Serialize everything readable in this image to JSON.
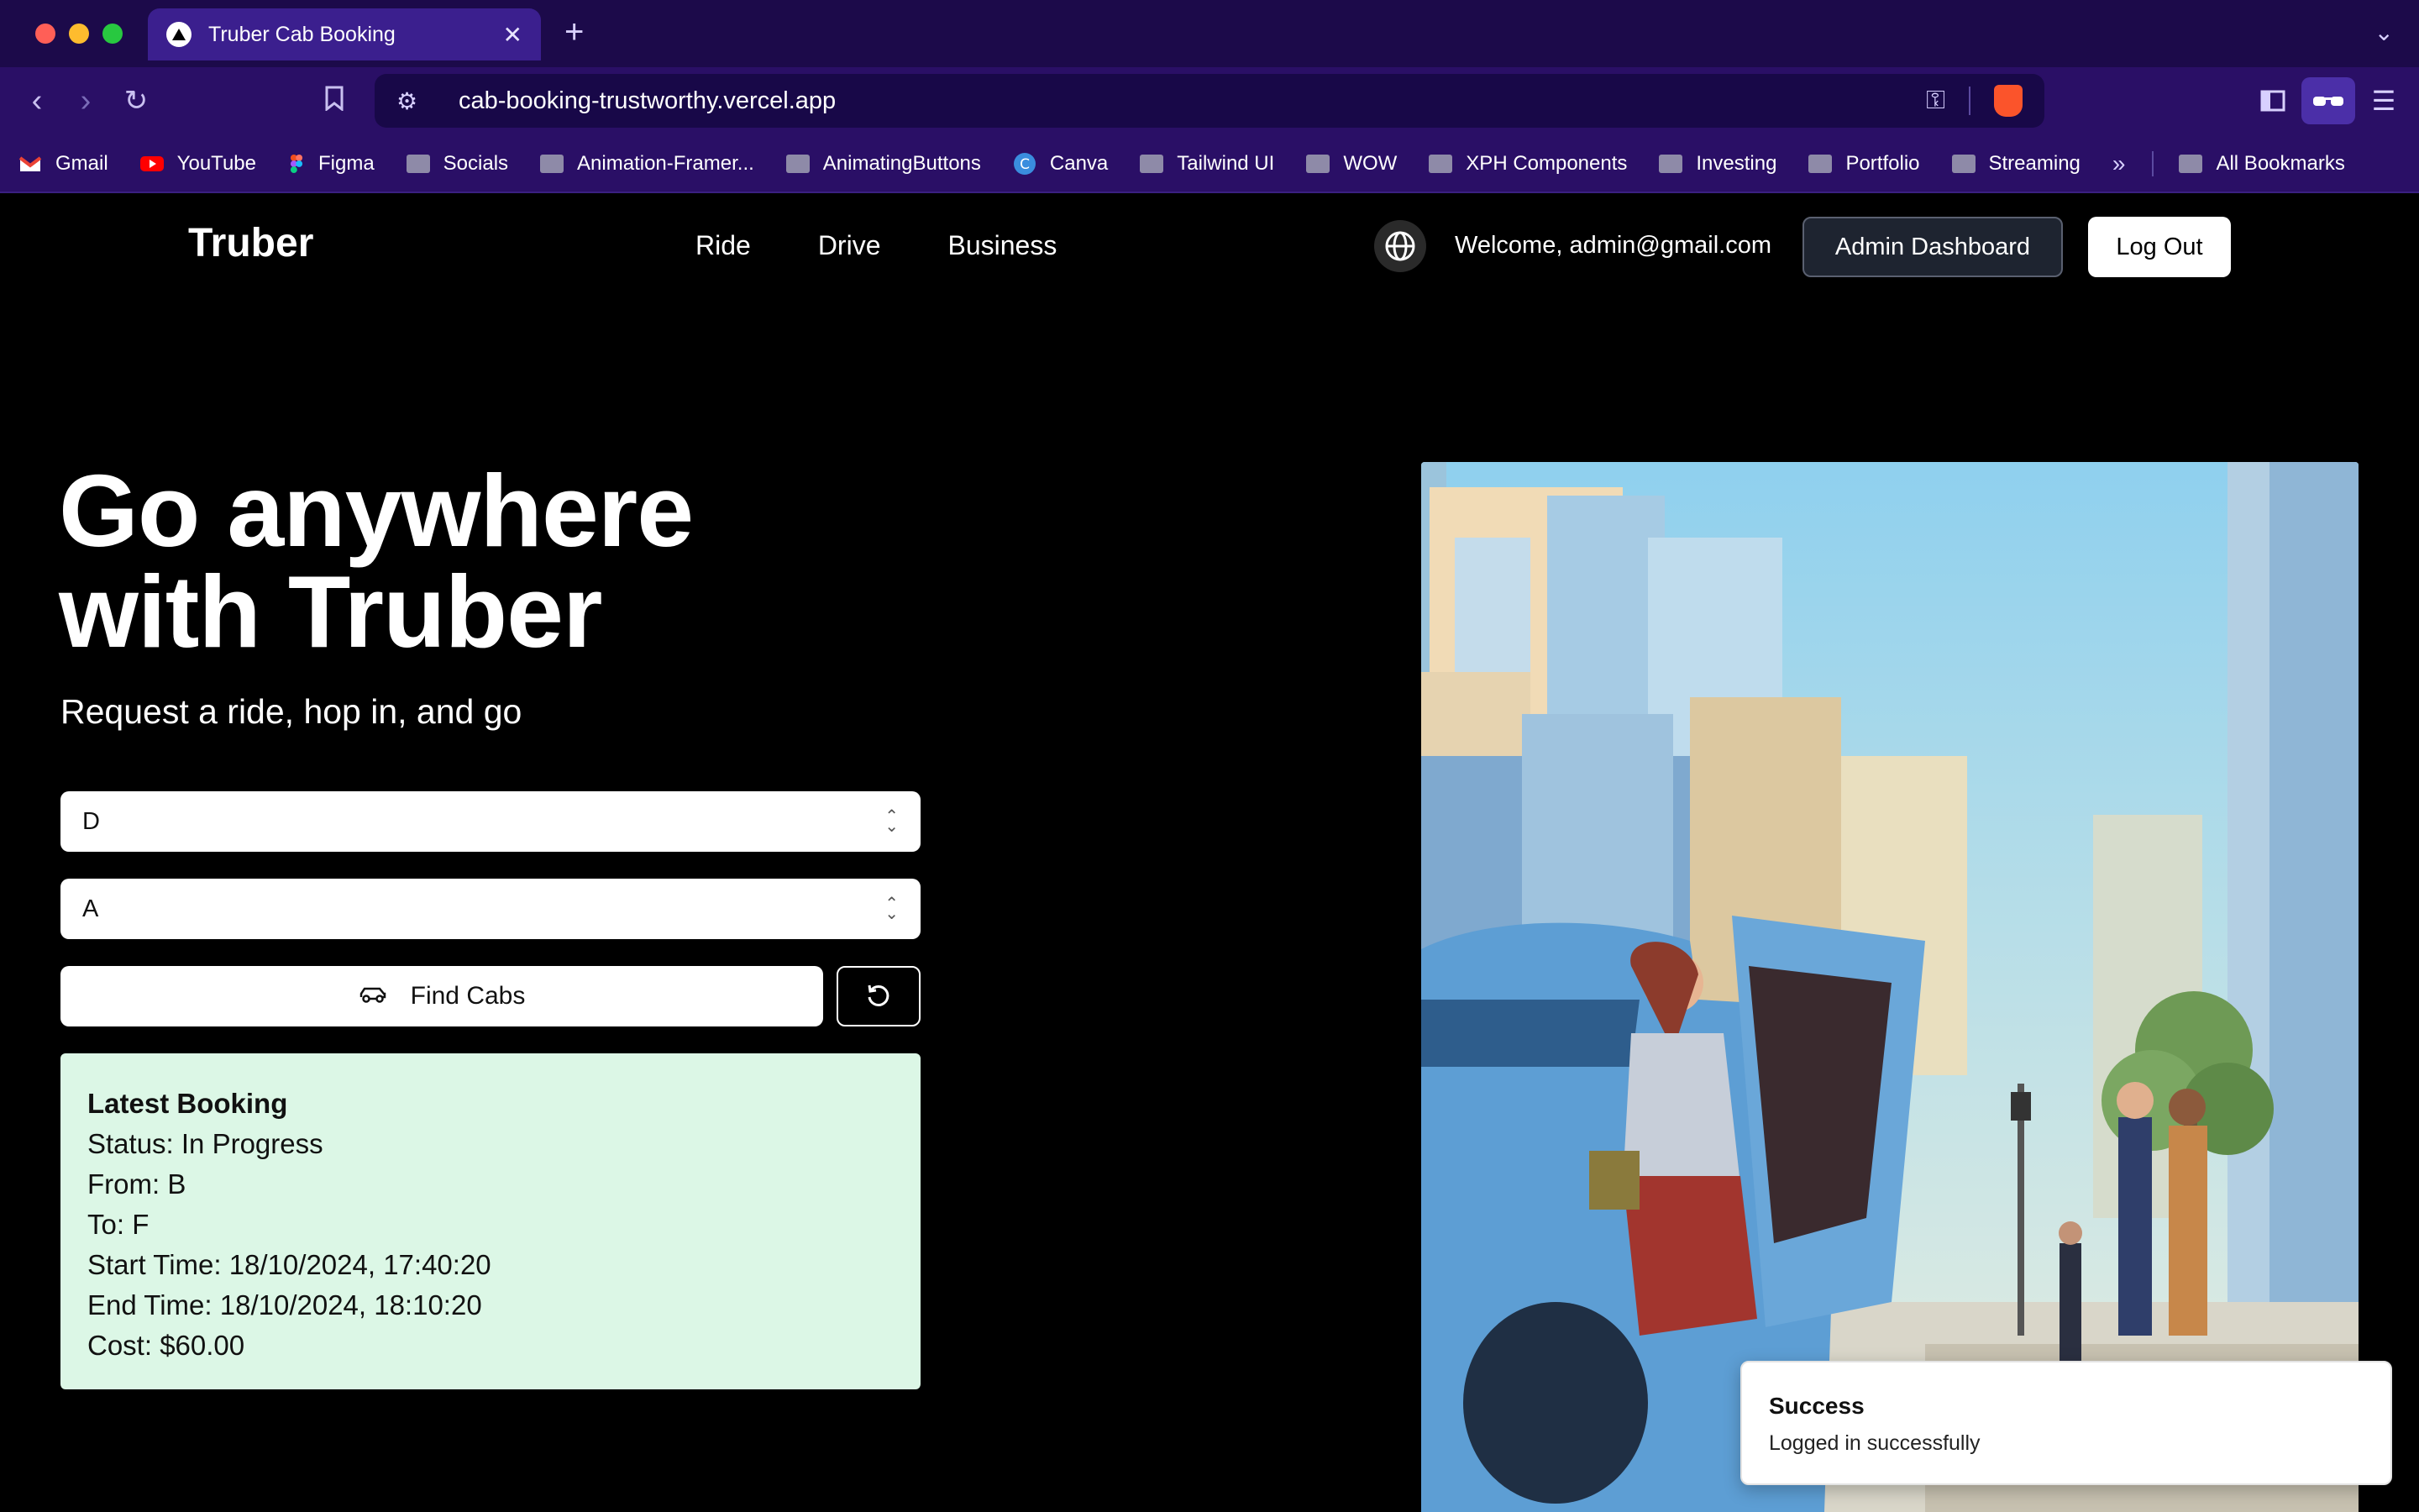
{
  "browser": {
    "tab_title": "Truber Cab Booking",
    "new_tab_icon": "plus-icon",
    "url": "cab-booking-trustworthy.vercel.app",
    "bookmarks": [
      {
        "label": "Gmail",
        "icon": "gmail-icon"
      },
      {
        "label": "YouTube",
        "icon": "youtube-icon"
      },
      {
        "label": "Figma",
        "icon": "figma-icon"
      },
      {
        "label": "Socials",
        "icon": "folder-icon"
      },
      {
        "label": "Animation-Framer...",
        "icon": "folder-icon"
      },
      {
        "label": "AnimatingButtons",
        "icon": "folder-icon"
      },
      {
        "label": "Canva",
        "icon": "canva-icon"
      },
      {
        "label": "Tailwind UI",
        "icon": "folder-icon"
      },
      {
        "label": "WOW",
        "icon": "folder-icon"
      },
      {
        "label": "XPH Components",
        "icon": "folder-icon"
      },
      {
        "label": "Investing",
        "icon": "folder-icon"
      },
      {
        "label": "Portfolio",
        "icon": "folder-icon"
      },
      {
        "label": "Streaming",
        "icon": "folder-icon"
      }
    ],
    "all_bookmarks": "All Bookmarks",
    "colors": {
      "chrome_bg": "#2a0f66",
      "tab_active": "#3b1f8e"
    }
  },
  "header": {
    "logo": "Truber",
    "nav": [
      "Ride",
      "Drive",
      "Business"
    ],
    "welcome": "Welcome, admin@gmail.com",
    "admin_button": "Admin Dashboard",
    "logout_button": "Log Out"
  },
  "hero": {
    "title_line1": "Go anywhere",
    "title_line2": "with Truber",
    "subtitle": "Request a ride, hop in, and go"
  },
  "form": {
    "from_value": "D",
    "to_value": "A",
    "find_button": "Find Cabs"
  },
  "booking": {
    "title": "Latest Booking",
    "status": "Status: In Progress",
    "from": "From: B",
    "to": "To: F",
    "start": "Start Time: 18/10/2024, 17:40:20",
    "end": "End Time: 18/10/2024, 18:10:20",
    "cost": "Cost: $60.00",
    "bg_color": "#dcf7e6"
  },
  "toast": {
    "title": "Success",
    "message": "Logged in successfully"
  }
}
